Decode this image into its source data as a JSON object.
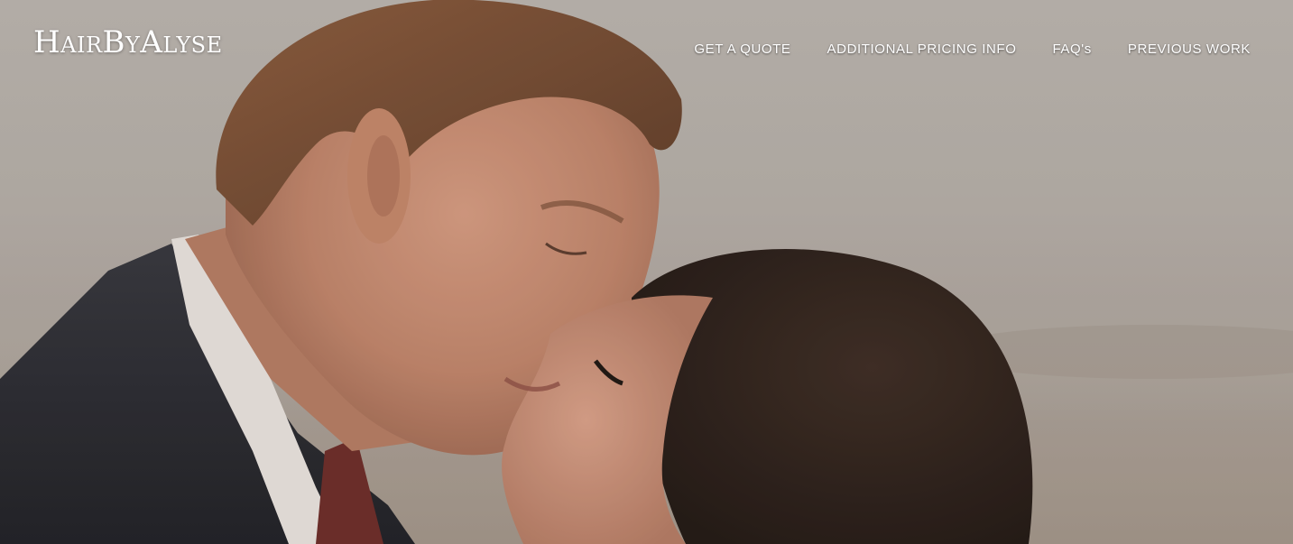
{
  "header": {
    "logo_text": "HairByAlyse",
    "nav": [
      {
        "label": "GET A QUOTE"
      },
      {
        "label": "ADDITIONAL PRICING INFO"
      },
      {
        "label": "FAQ's"
      },
      {
        "label": "PREVIOUS WORK"
      }
    ]
  },
  "hero": {
    "image": "hero-photo-couple-kissing"
  }
}
